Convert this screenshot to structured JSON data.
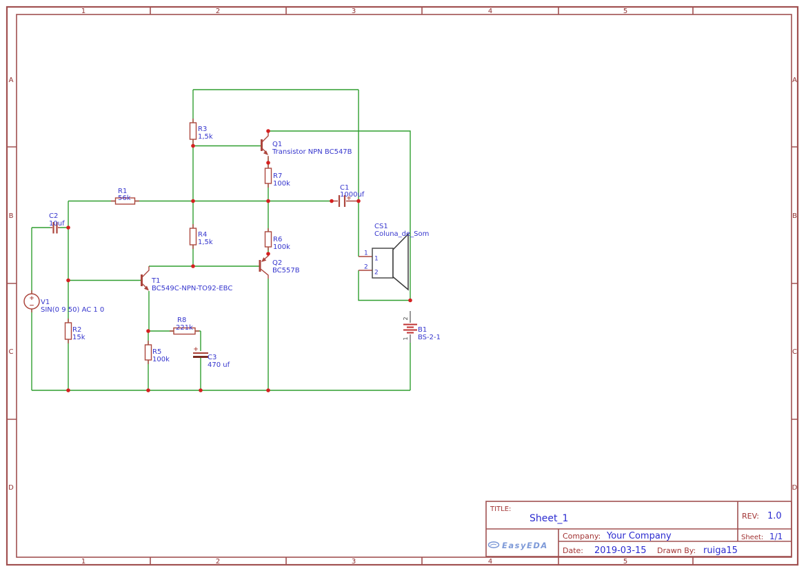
{
  "colors": {
    "wire": "#2f9e2f",
    "comp": "#ac453c",
    "dot": "#d42020",
    "lbl": "#3535cd",
    "frame": "#a05050",
    "frameText": "#8f3030",
    "tbLabel": "#a13232",
    "tbValue": "#2b2bd0",
    "gray": "#4a4a4a",
    "pin": "#777777",
    "batt": "#c03030",
    "logo": "#7e9ad8"
  },
  "frame": {
    "top": [
      "1",
      "2",
      "3",
      "4",
      "5"
    ],
    "bottom": [
      "1",
      "2",
      "3",
      "4",
      "5"
    ],
    "left": [
      "A",
      "B",
      "C",
      "D"
    ],
    "right": [
      "A",
      "B",
      "C",
      "D"
    ]
  },
  "title_block": {
    "title_label": "TITLE:",
    "title": "Sheet_1",
    "rev_label": "REV:",
    "rev": "1.0",
    "company_label": "Company:",
    "company": "Your Company",
    "sheet_label": "Sheet:",
    "sheet": "1/1",
    "date_label": "Date:",
    "date": "2019-03-15",
    "drawn_by_label": "Drawn By:",
    "drawn_by": "ruiga15",
    "logo_text": "EasyEDA"
  },
  "components": {
    "V1": {
      "ref": "V1",
      "value": "SIN(0 9 50) AC 1 0",
      "plus": "+",
      "minus": "−"
    },
    "C1": {
      "ref": "C1",
      "value": "1000uf",
      "plus": "+"
    },
    "C2": {
      "ref": "C2",
      "value": "10uf"
    },
    "C3": {
      "ref": "C3",
      "value": "470 uf",
      "plus": "+"
    },
    "R1": {
      "ref": "R1",
      "value": "56k"
    },
    "R2": {
      "ref": "R2",
      "value": "15k"
    },
    "R3": {
      "ref": "R3",
      "value": "1,5k"
    },
    "R4": {
      "ref": "R4",
      "value": "1,5k"
    },
    "R5": {
      "ref": "R5",
      "value": "100k"
    },
    "R6": {
      "ref": "R6",
      "value": "100k"
    },
    "R7": {
      "ref": "R7",
      "value": "100k"
    },
    "R8": {
      "ref": "R8",
      "value": "221k"
    },
    "Q1": {
      "ref": "Q1",
      "value": "Transistor NPN BC547B"
    },
    "Q2": {
      "ref": "Q2",
      "value": "BC557B"
    },
    "T1": {
      "ref": "T1",
      "value": "BC549C-NPN-TO92-EBC"
    },
    "CS1": {
      "ref": "CS1",
      "value": "Coluna_de_Som",
      "pin1": "1",
      "pin2": "2"
    },
    "B1": {
      "ref": "B1",
      "value": "BS-2-1",
      "term_top": "2",
      "term_bottom": "1"
    }
  }
}
